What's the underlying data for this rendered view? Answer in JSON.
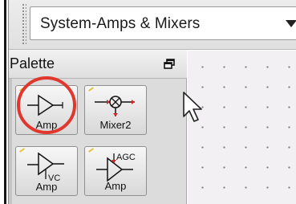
{
  "toolbar": {
    "selector_value": "System-Amps & Mixers",
    "dropdown_icon": "chevron-down-icon"
  },
  "palette": {
    "title": "Palette",
    "restore_icon": "window-restore-icon",
    "items": [
      {
        "label": "Amp",
        "icon": "amplifier-icon"
      },
      {
        "label": "Mixer2",
        "icon": "mixer-icon"
      },
      {
        "label": "VC\nAmp",
        "icon": "vc-amplifier-icon"
      },
      {
        "label": "Amp",
        "icon": "agc-amplifier-icon"
      }
    ],
    "vc_text": "VC",
    "agc_text": "AGC"
  },
  "annotation": {
    "highlight_color": "#e0382e"
  },
  "colors": {
    "palette_bg": "#dcdcdc",
    "canvas_bg": "#f2f0f2",
    "mixer_accent": "#d22828"
  }
}
